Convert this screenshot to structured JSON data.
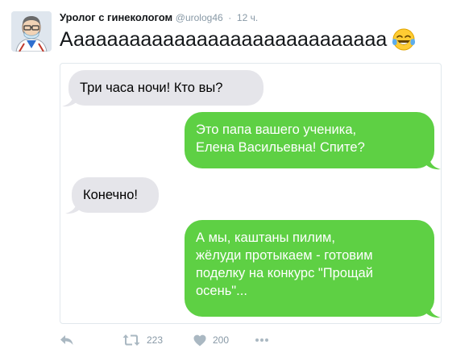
{
  "tweet": {
    "author_name": "Уролог с гинекологом",
    "handle": "@urolog46",
    "separator": "·",
    "time": "12 ч.",
    "text": "Ааааааааааааааааааааааааааааа",
    "emoji": "tears-of-joy-emoji"
  },
  "chat": {
    "messages": [
      {
        "side": "incoming",
        "text": "Три часа ночи! Кто вы?"
      },
      {
        "side": "outgoing",
        "lines": [
          "Это папа вашего ученика,",
          "Елена Васильевна! Спите?"
        ]
      },
      {
        "side": "incoming",
        "text": "Конечно!"
      },
      {
        "side": "outgoing",
        "lines": [
          "А мы, каштаны пилим,",
          "жёлуди протыкаем - готовим",
          "поделку на конкурс \"Прощай",
          "осень\"..."
        ]
      }
    ],
    "colors": {
      "incoming": "#e5e5ea",
      "outgoing": "#5ed044"
    }
  },
  "actions": {
    "reply_icon": "reply-icon",
    "retweet_icon": "retweet-icon",
    "retweet_count": "223",
    "like_icon": "heart-icon",
    "like_count": "200",
    "more_icon": "more-icon"
  }
}
